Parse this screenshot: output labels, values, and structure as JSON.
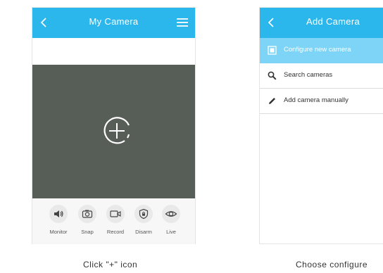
{
  "screen1": {
    "title": "My Camera",
    "caption": "Click \"+\" icon",
    "controls": [
      {
        "label": "Monitor",
        "icon": "speaker-icon"
      },
      {
        "label": "Snap",
        "icon": "camera-icon"
      },
      {
        "label": "Record",
        "icon": "video-icon"
      },
      {
        "label": "Disarm",
        "icon": "shield-icon"
      },
      {
        "label": "Live",
        "icon": "eye-icon"
      }
    ]
  },
  "screen2": {
    "title": "Add Camera",
    "caption": "Choose configure",
    "items": [
      {
        "label": "Configure new camera",
        "icon": "checkbox-icon"
      },
      {
        "label": "Search cameras",
        "icon": "search-icon"
      },
      {
        "label": "Add camera manually",
        "icon": "pencil-icon"
      }
    ]
  },
  "colors": {
    "topbar": "#2cb7ec",
    "highlight": "#7dd4f7",
    "video_bg": "#575d57"
  }
}
